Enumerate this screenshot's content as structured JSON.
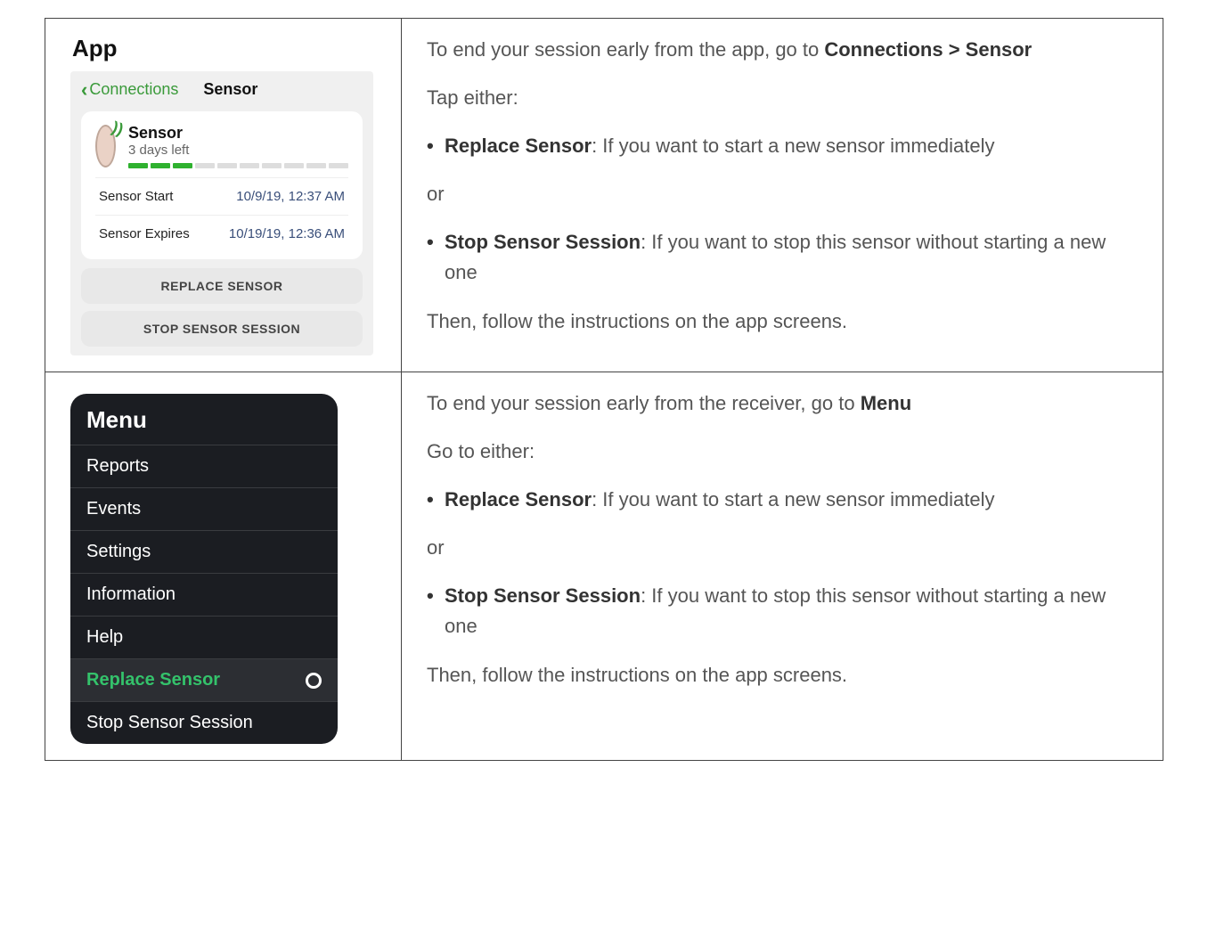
{
  "row1": {
    "left": {
      "heading": "App",
      "nav_back": "Connections",
      "nav_title": "Sensor",
      "sensor_name": "Sensor",
      "sensor_sub": "3 days left",
      "info_start_label": "Sensor Start",
      "info_start_value": "10/9/19, 12:37 AM",
      "info_expires_label": "Sensor Expires",
      "info_expires_value": "10/19/19, 12:36 AM",
      "btn_replace": "REPLACE SENSOR",
      "btn_stop": "STOP SENSOR SESSION"
    },
    "right": {
      "p1a": "To end your session early from the app, go to ",
      "p1b": "Connections > Sensor",
      "p2": "Tap either:",
      "b1_bold": "Replace Sensor",
      "b1_rest": ": If you want to start a new sensor immediately",
      "or": "or",
      "b2_bold": "Stop Sensor Session",
      "b2_rest": ": If you want to stop this sensor without starting a new one",
      "p3": "Then, follow the instructions on the app screens."
    }
  },
  "row2": {
    "left": {
      "title": "Menu",
      "items": {
        "reports": "Reports",
        "events": "Events",
        "settings": "Settings",
        "information": "Information",
        "help": "Help",
        "replace": "Replace Sensor",
        "stop": "Stop Sensor Session"
      }
    },
    "right": {
      "p1a": "To end your session early from the receiver, go to ",
      "p1b": "Menu",
      "p2": "Go to either:",
      "b1_bold": "Replace Sensor",
      "b1_rest": ": If you want to start a new sensor immediately",
      "or": "or",
      "b2_bold": "Stop Sensor Session",
      "b2_rest": ": If you want to stop this sensor without starting a new one",
      "p3": "Then, follow the instructions on the app screens."
    }
  }
}
